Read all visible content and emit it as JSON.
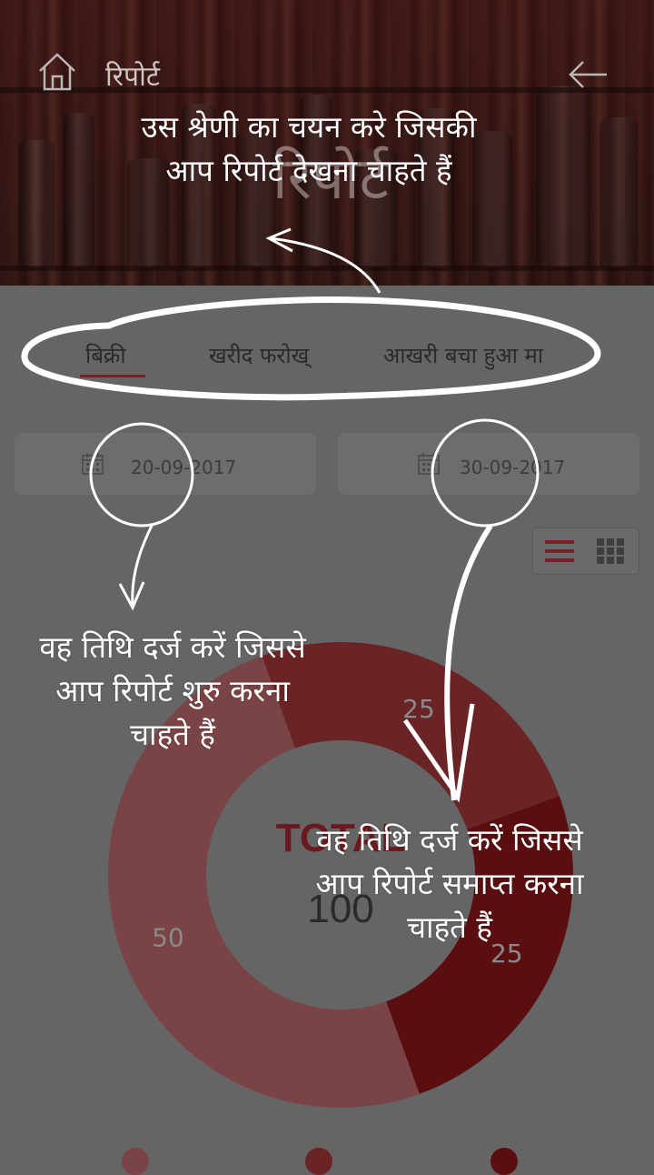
{
  "header": {
    "title": "रिपोर्ट",
    "big_title": "रिपोर्ट"
  },
  "tabs": [
    {
      "label": "बिक्री",
      "active": true
    },
    {
      "label": "खरीद फरोख्",
      "active": false
    },
    {
      "label": "आखरी बचा हुआ मा",
      "active": false
    }
  ],
  "dates": {
    "start": "20-09-2017",
    "end": "30-09-2017"
  },
  "chart_data": {
    "type": "pie",
    "categories": [
      "",
      "",
      ""
    ],
    "values": [
      25,
      25,
      50
    ],
    "data_labels": [
      "25",
      "25",
      "50"
    ],
    "center_label": "TOTAL",
    "center_value": "100",
    "colors": [
      "#6a2426",
      "#5a0e10",
      "#7a4446"
    ]
  },
  "annotations": {
    "category_hint_line1": "उस श्रेणी का चयन करे जिसकी",
    "category_hint_line2": "आप रिपोर्ट देखना चाहते हैं",
    "start_hint_line1": "वह तिथि दर्ज करें जिससे",
    "start_hint_line2": "आप रिपोर्ट शुरु करना",
    "start_hint_line3": "चाहते हैं",
    "end_hint_line1": "वह तिथि दर्ज करें जिससे",
    "end_hint_line2": "आप रिपोर्ट समाप्त करना",
    "end_hint_line3": "चाहते हैं"
  },
  "colors": {
    "overlay": "#656565",
    "accent": "#7a1e28"
  }
}
